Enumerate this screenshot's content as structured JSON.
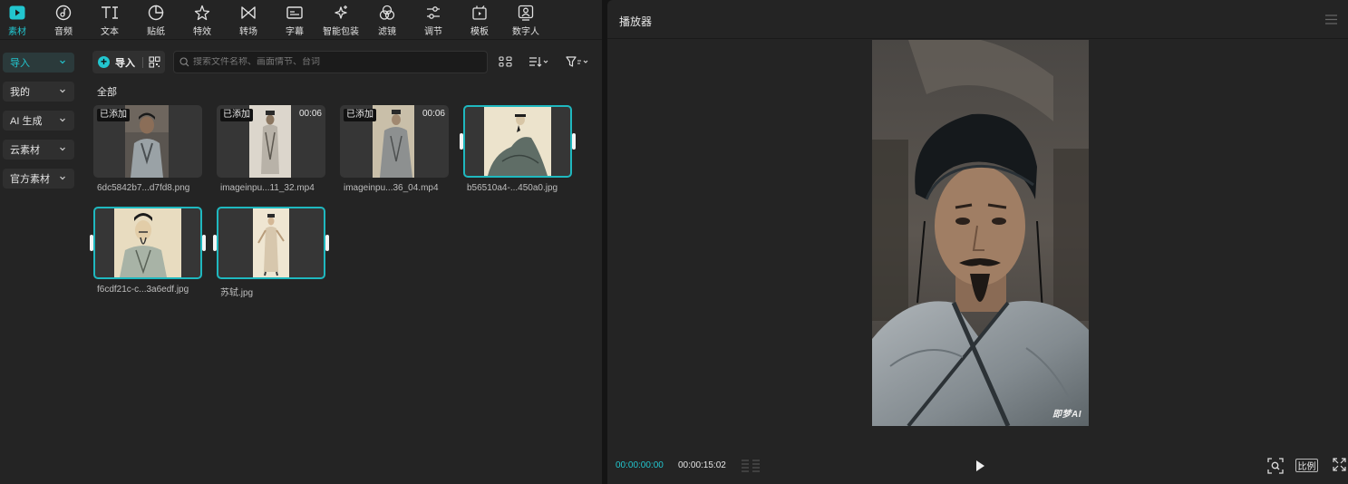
{
  "toolbar": {
    "items": [
      {
        "label": "素材",
        "icon": "media-icon",
        "active": true
      },
      {
        "label": "音频",
        "icon": "audio-icon"
      },
      {
        "label": "文本",
        "icon": "text-icon"
      },
      {
        "label": "贴纸",
        "icon": "sticker-icon"
      },
      {
        "label": "特效",
        "icon": "effects-icon"
      },
      {
        "label": "转场",
        "icon": "transition-icon"
      },
      {
        "label": "字幕",
        "icon": "subtitle-icon"
      },
      {
        "label": "智能包装",
        "icon": "smart-pack-icon"
      },
      {
        "label": "滤镜",
        "icon": "filter-icon"
      },
      {
        "label": "调节",
        "icon": "adjust-icon"
      },
      {
        "label": "模板",
        "icon": "template-icon"
      },
      {
        "label": "数字人",
        "icon": "digital-human-icon"
      }
    ]
  },
  "sidebar": {
    "items": [
      {
        "label": "导入",
        "active": true
      },
      {
        "label": "我的"
      },
      {
        "label": "AI 生成"
      },
      {
        "label": "云素材"
      },
      {
        "label": "官方素材"
      }
    ]
  },
  "media_toolbar": {
    "import_label": "导入",
    "search_placeholder": "搜索文件名称、画面情节、台词"
  },
  "media": {
    "section_title": "全部",
    "items": [
      {
        "name": "6dc5842b7...d7fd8.png",
        "badge": "已添加",
        "duration": ""
      },
      {
        "name": "imageinpu...11_32.mp4",
        "badge": "已添加",
        "duration": "00:06"
      },
      {
        "name": "imageinpu...36_04.mp4",
        "badge": "已添加",
        "duration": "00:06"
      },
      {
        "name": "b56510a4-...450a0.jpg",
        "badge": "",
        "duration": ""
      },
      {
        "name": "f6cdf21c-c...3a6edf.jpg",
        "badge": "",
        "duration": ""
      },
      {
        "name": "苏轼.jpg",
        "badge": "",
        "duration": ""
      }
    ]
  },
  "player": {
    "title": "播放器",
    "watermark": "即梦AI",
    "time_current": "00:00:00:00",
    "time_total": "00:00:15:02",
    "ratio_label": "比例"
  },
  "colors": {
    "accent": "#22c6cf",
    "panel": "#242424",
    "background": "#141414"
  }
}
